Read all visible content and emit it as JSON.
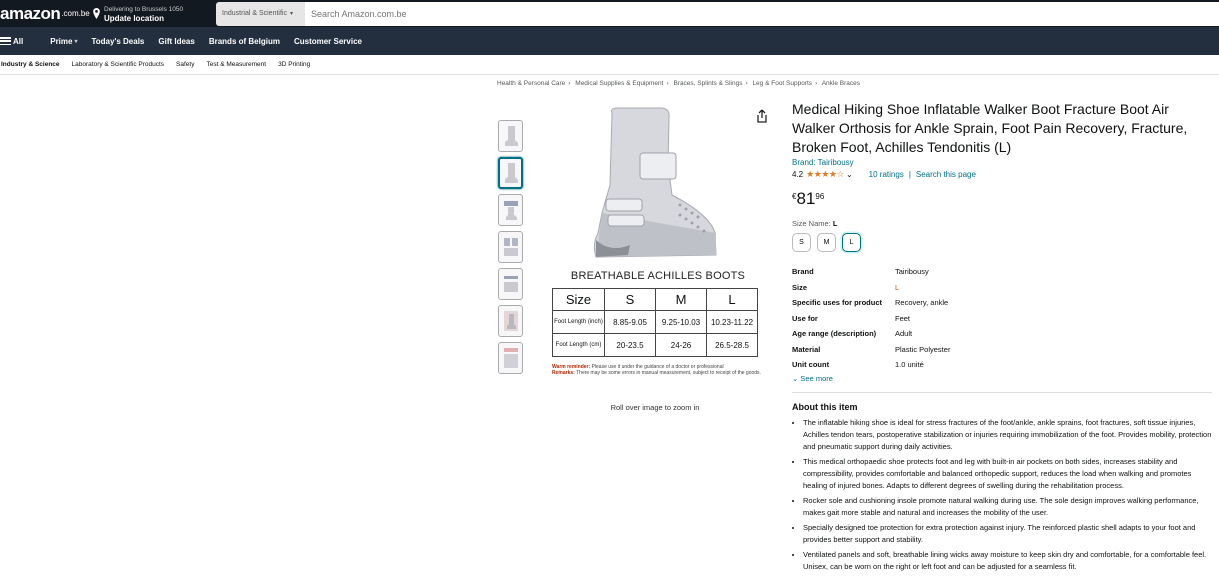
{
  "header": {
    "logo": "amazon",
    "logo_tld": ".com.be",
    "deliver_small": "Delivering to Brussels 1050",
    "deliver_big": "Update location",
    "search_category": "Industrial & Scientific",
    "search_placeholder": "Search Amazon.com.be"
  },
  "nav": {
    "all": "All",
    "items": [
      "Prime",
      "Today's Deals",
      "Gift Ideas",
      "Brands of Belgium",
      "Customer Service"
    ]
  },
  "subnav": {
    "items": [
      "Industry & Science",
      "Laboratory & Scientific Products",
      "Safety",
      "Test & Measurement",
      "3D Printing"
    ]
  },
  "breadcrumb": [
    "Health & Personal Care",
    "Medical Supplies & Equipment",
    "Braces, Splints & Slings",
    "Leg & Foot Supports",
    "Ankle Braces"
  ],
  "gallery": {
    "caption": "BREATHABLE ACHILLES BOOTS",
    "zoom_hint": "Roll over image to zoom in",
    "table": {
      "headers": [
        "Size",
        "S",
        "M",
        "L"
      ],
      "rows": [
        {
          "label": "Foot Length (inch)",
          "values": [
            "8.85-9.05",
            "9.25-10.03",
            "10.23-11.22"
          ]
        },
        {
          "label": "Foot Length (cm)",
          "values": [
            "20-23.5",
            "24-26",
            "26.5-28.5"
          ]
        }
      ]
    },
    "warm_label": "Warm reminder:",
    "warm_text": "Please use it under the guidance of a doctor or professional",
    "remarks_label": "Remarks:",
    "remarks_text": "There may be some errors in manual measurement, subject to receipt of the goods."
  },
  "product": {
    "title": "Medical Hiking Shoe Inflatable Walker Boot Fracture Boot Air Walker Orthosis for Ankle Sprain, Foot Pain Recovery, Fracture, Broken Foot, Achilles Tendonitis (L)",
    "brand_link": "Brand: Tairibousy",
    "rating": "4.2",
    "stars": "★★★★☆",
    "ratings_count": "10 ratings",
    "search_page": "Search this page",
    "price_currency": "€",
    "price_whole": "81",
    "price_fraction": "96",
    "size_label": "Size Name:",
    "size_selected": "L",
    "sizes": [
      "S",
      "M",
      "L"
    ],
    "see_more": "See more",
    "about_title": "About this item"
  },
  "specs": [
    {
      "key": "Brand",
      "value": "Tairibousy"
    },
    {
      "key": "Size",
      "value": "L"
    },
    {
      "key": "Specific uses for product",
      "value": "Recovery, ankle"
    },
    {
      "key": "Use for",
      "value": "Feet"
    },
    {
      "key": "Age range (description)",
      "value": "Adult"
    },
    {
      "key": "Material",
      "value": "Plastic Polyester"
    },
    {
      "key": "Unit count",
      "value": "1.0 unité"
    }
  ],
  "bullets": [
    "The inflatable hiking shoe is ideal for stress fractures of the foot/ankle, ankle sprains, foot fractures, soft tissue injuries, Achilles tendon tears, postoperative stabilization or injuries requiring immobilization of the foot. Provides mobility, protection and pneumatic support during daily activities.",
    "This medical orthopaedic shoe protects foot and leg with built-in air pockets on both sides, increases stability and compressibility, provides comfortable and balanced orthopedic support, reduces the load when walking and promotes healing of injured bones. Adapts to different degrees of swelling during the rehabilitation process.",
    "Rocker sole and cushioning insole promote natural walking during use. The sole design improves walking performance, makes gait more stable and natural and increases the mobility of the user.",
    "Specially designed toe protection for extra protection against injury. The reinforced plastic shell adapts to your foot and provides better support and stability.",
    "Ventilated panels and soft, breathable lining wicks away moisture to keep skin dry and comfortable, for a comfortable feel. Unisex, can be worn on the right or left foot and can be adjusted for a seamless fit."
  ]
}
